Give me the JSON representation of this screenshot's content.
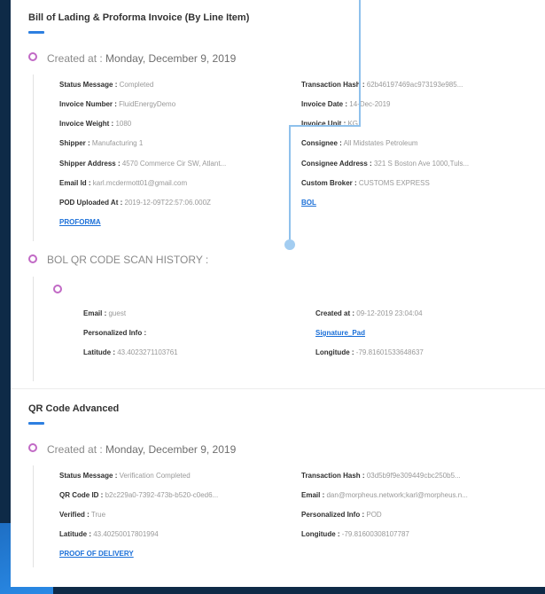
{
  "section1": {
    "title": "Bill of Lading & Proforma Invoice (By Line Item)",
    "created_label": "Created at :",
    "created_date": "Monday, December 9, 2019",
    "left": [
      {
        "label": "Status Message :",
        "value": "Completed"
      },
      {
        "label": "Invoice Number :",
        "value": "FluidEnergyDemo"
      },
      {
        "label": "Invoice Weight :",
        "value": "1080"
      },
      {
        "label": "Shipper :",
        "value": "Manufacturing 1"
      },
      {
        "label": "Shipper Address :",
        "value": "4570 Commerce Cir SW, Atlant..."
      },
      {
        "label": "Email Id :",
        "value": "karl.mcdermott01@gmail.com"
      },
      {
        "label": "POD Uploaded At :",
        "value": "2019-12-09T22:57:06.000Z"
      }
    ],
    "right": [
      {
        "label": "Transaction Hash :",
        "value": "62b46197469ac973193e985..."
      },
      {
        "label": "Invoice Date :",
        "value": "14-Dec-2019"
      },
      {
        "label": "Invoice Unit :",
        "value": "KG"
      },
      {
        "label": "Consignee :",
        "value": "All Midstates Petroleum"
      },
      {
        "label": "Consignee Address :",
        "value": "321 S Boston Ave 1000,Tuls..."
      },
      {
        "label": "Custom Broker :",
        "value": "CUSTOMS EXPRESS"
      }
    ],
    "link_left": "PROFORMA",
    "link_right": "BOL"
  },
  "scan_history": {
    "title": "BOL QR CODE SCAN HISTORY :",
    "left": [
      {
        "label": "Email :",
        "value": "guest"
      },
      {
        "label": "Personalized Info :",
        "value": ""
      },
      {
        "label": "Latitude :",
        "value": "43.4023271103761"
      }
    ],
    "right": [
      {
        "label": "Created at :",
        "value": "09-12-2019 23:04:04"
      },
      {
        "label": "Longitude :",
        "value": "-79.81601533648637"
      }
    ],
    "link_right": "Signature_Pad"
  },
  "section2": {
    "title": "QR Code Advanced",
    "created_label": "Created at :",
    "created_date": "Monday, December 9, 2019",
    "left": [
      {
        "label": "Status Message :",
        "value": "Verification Completed"
      },
      {
        "label": "QR Code ID :",
        "value": "b2c229a0-7392-473b-b520-c0ed6..."
      },
      {
        "label": "Verified :",
        "value": "True"
      },
      {
        "label": "Latitude :",
        "value": "43.40250017801994"
      }
    ],
    "right": [
      {
        "label": "Transaction Hash :",
        "value": "03d5b9f9e309449cbc250b5..."
      },
      {
        "label": "Email :",
        "value": "dan@morpheus.network;karl@morpheus.n..."
      },
      {
        "label": "Personalized Info :",
        "value": "POD"
      },
      {
        "label": "Longitude :",
        "value": "-79.81600308107787"
      }
    ],
    "link_left": "PROOF OF DELIVERY"
  },
  "colors": {
    "accent": "#2d7fe0",
    "timeline_dot": "#c169c5",
    "link": "#1a6fd8",
    "connector": "#8fc1ec",
    "background": "#0e2a47"
  }
}
